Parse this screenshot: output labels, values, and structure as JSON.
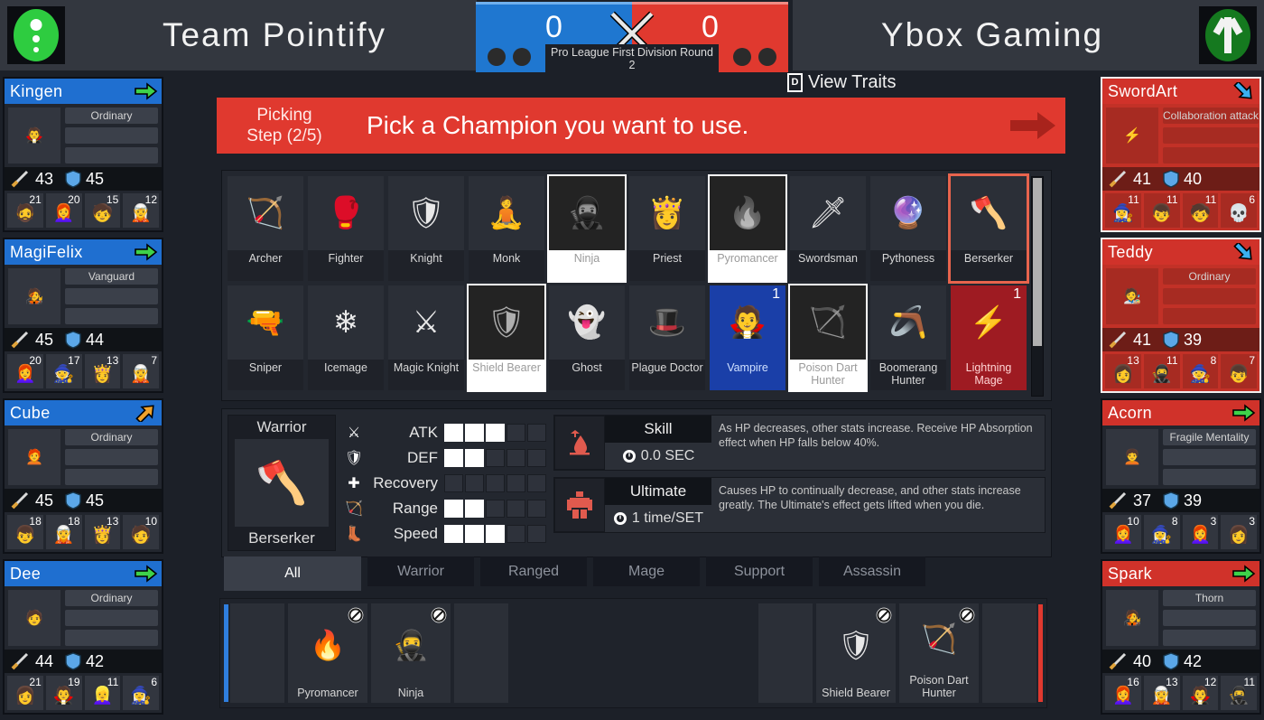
{
  "header": {
    "blue_team_name": "Team Pointify",
    "red_team_name": "Ybox Gaming",
    "blue_score": "0",
    "red_score": "0",
    "round_label": "Pro League First Division Round 2",
    "view_traits_label": "View Traits",
    "view_traits_key": "D",
    "vs_icon": "crossed-swords-icon",
    "blue_logo_icon": "green-oval-dots-logo",
    "red_logo_icon": "green-oval-y-logo"
  },
  "banner": {
    "step_line1": "Picking",
    "step_line2": "Step (2/5)",
    "message": "Pick a Champion you want to use.",
    "arrow_icon": "right-arrow-icon",
    "color": "#e0392f"
  },
  "left_players": [
    {
      "name": "Kingen",
      "arrow": "right-arrow-icon",
      "trait": "Ordinary",
      "atk": "43",
      "def": "45",
      "avatar": "🧛",
      "units": [
        {
          "count": "21",
          "sprite": "🧔"
        },
        {
          "count": "20",
          "sprite": "👩‍🦰"
        },
        {
          "count": "15",
          "sprite": "🧒"
        },
        {
          "count": "12",
          "sprite": "🧝"
        }
      ]
    },
    {
      "name": "MagiFelix",
      "arrow": "right-arrow-icon",
      "trait": "Vanguard",
      "atk": "45",
      "def": "44",
      "avatar": "🧑‍🎤",
      "units": [
        {
          "count": "20",
          "sprite": "👩‍🦰"
        },
        {
          "count": "17",
          "sprite": "🧙"
        },
        {
          "count": "13",
          "sprite": "👸"
        },
        {
          "count": "7",
          "sprite": "🧝"
        }
      ]
    },
    {
      "name": "Cube",
      "arrow": "up-right-arrow-icon",
      "trait": "Ordinary",
      "atk": "45",
      "def": "45",
      "avatar": "🧑‍🦰",
      "units": [
        {
          "count": "18",
          "sprite": "👦"
        },
        {
          "count": "18",
          "sprite": "🧝"
        },
        {
          "count": "13",
          "sprite": "👸"
        },
        {
          "count": "10",
          "sprite": "🧑"
        }
      ]
    },
    {
      "name": "Dee",
      "arrow": "right-arrow-icon",
      "trait": "Ordinary",
      "atk": "44",
      "def": "42",
      "avatar": "🧑",
      "units": [
        {
          "count": "21",
          "sprite": "👩"
        },
        {
          "count": "19",
          "sprite": "🧛"
        },
        {
          "count": "11",
          "sprite": "👱‍♀️"
        },
        {
          "count": "6",
          "sprite": "🧙‍♀️"
        }
      ]
    }
  ],
  "right_players": [
    {
      "name": "SwordArt",
      "arrow": "down-right-arrow-icon",
      "trait": "Collaboration attack",
      "atk": "41",
      "def": "40",
      "avatar": "⚡",
      "style": "red",
      "units": [
        {
          "count": "11",
          "sprite": "🧙‍♀️"
        },
        {
          "count": "11",
          "sprite": "👦"
        },
        {
          "count": "11",
          "sprite": "🧒"
        },
        {
          "count": "6",
          "sprite": "💀"
        }
      ]
    },
    {
      "name": "Teddy",
      "arrow": "down-right-arrow-icon",
      "trait": "Ordinary",
      "atk": "41",
      "def": "39",
      "avatar": "🧑‍🎨",
      "style": "red",
      "units": [
        {
          "count": "13",
          "sprite": "👩"
        },
        {
          "count": "11",
          "sprite": "🥷"
        },
        {
          "count": "8",
          "sprite": "🧙"
        },
        {
          "count": "7",
          "sprite": "👦"
        }
      ]
    },
    {
      "name": "Acorn",
      "arrow": "right-arrow-icon",
      "trait": "Fragile Mentality",
      "atk": "37",
      "def": "39",
      "avatar": "🧑‍🦱",
      "style": "dark",
      "units": [
        {
          "count": "10",
          "sprite": "👩‍🦰"
        },
        {
          "count": "8",
          "sprite": "🧙‍♀️"
        },
        {
          "count": "3",
          "sprite": "👩‍🦰"
        },
        {
          "count": "3",
          "sprite": "👩"
        }
      ]
    },
    {
      "name": "Spark",
      "arrow": "right-arrow-icon",
      "trait": "Thorn",
      "atk": "40",
      "def": "42",
      "avatar": "🧑‍🎤",
      "style": "dark",
      "units": [
        {
          "count": "16",
          "sprite": "👩‍🦰"
        },
        {
          "count": "13",
          "sprite": "🧝"
        },
        {
          "count": "12",
          "sprite": "🧛"
        },
        {
          "count": "11",
          "sprite": "🥷"
        }
      ]
    }
  ],
  "champion_grid": {
    "row1": [
      {
        "name": "Archer",
        "state": "normal",
        "sprite": "🏹"
      },
      {
        "name": "Fighter",
        "state": "normal",
        "sprite": "🥊"
      },
      {
        "name": "Knight",
        "state": "normal",
        "sprite": "🛡"
      },
      {
        "name": "Monk",
        "state": "normal",
        "sprite": "🧘"
      },
      {
        "name": "Ninja",
        "state": "banned",
        "sprite": "🥷"
      },
      {
        "name": "Priest",
        "state": "normal",
        "sprite": "👸"
      },
      {
        "name": "Pyromancer",
        "state": "banned",
        "sprite": "🔥"
      },
      {
        "name": "Swordsman",
        "state": "normal",
        "sprite": "🗡"
      },
      {
        "name": "Pythoness",
        "state": "normal",
        "sprite": "🔮"
      },
      {
        "name": "Berserker",
        "state": "selected",
        "sprite": "🪓"
      }
    ],
    "row2": [
      {
        "name": "Sniper",
        "state": "normal",
        "sprite": "🔫"
      },
      {
        "name": "Icemage",
        "state": "normal",
        "sprite": "❄"
      },
      {
        "name": "Magic Knight",
        "state": "normal",
        "sprite": "⚔"
      },
      {
        "name": "Shield Bearer",
        "state": "banned",
        "sprite": "🛡"
      },
      {
        "name": "Ghost",
        "state": "normal",
        "sprite": "👻"
      },
      {
        "name": "Plague Doctor",
        "state": "normal",
        "sprite": "🎩"
      },
      {
        "name": "Vampire",
        "state": "pickblue",
        "count": "1",
        "sprite": "🧛"
      },
      {
        "name": "Poison Dart Hunter",
        "state": "banned",
        "sprite": "🏹"
      },
      {
        "name": "Boomerang Hunter",
        "state": "normal",
        "sprite": "🪃"
      },
      {
        "name": "Lightning Mage",
        "state": "pickred",
        "count": "1",
        "sprite": "⚡"
      }
    ],
    "ban_icon": "prohibited-icon"
  },
  "detail": {
    "class_tag": "Warrior",
    "champion_name": "Berserker",
    "sprite": "🪓",
    "stats": [
      {
        "icon": "crossed-swords-icon",
        "glyph": "⚔",
        "label": "ATK",
        "value": 3,
        "max": 5
      },
      {
        "icon": "shield-icon",
        "glyph": "🛡",
        "label": "DEF",
        "value": 2,
        "max": 5
      },
      {
        "icon": "plus-cross-icon",
        "glyph": "✚",
        "label": "Recovery",
        "value": 0,
        "max": 5
      },
      {
        "icon": "bow-icon",
        "glyph": "🏹",
        "label": "Range",
        "value": 2,
        "max": 5
      },
      {
        "icon": "boot-icon",
        "glyph": "👢",
        "label": "Speed",
        "value": 3,
        "max": 5
      }
    ],
    "skill": {
      "icon": "blood-drop-up-icon",
      "title": "Skill",
      "cost_icon": "clock-icon",
      "cost": "0.0 SEC",
      "description": "As HP decreases, other stats increase. Receive HP Absorption effect when HP falls below 40%."
    },
    "ultimate": {
      "icon": "armored-figure-icon",
      "title": "Ultimate",
      "cost_icon": "clock-icon",
      "cost": "1 time/SET",
      "description": "Causes HP to continually decrease, and other stats increase greatly. The Ultimate's effect gets lifted when you die."
    }
  },
  "filter_tabs": [
    {
      "label": "All",
      "active": true
    },
    {
      "label": "Warrior",
      "active": false
    },
    {
      "label": "Ranged",
      "active": false
    },
    {
      "label": "Mage",
      "active": false
    },
    {
      "label": "Support",
      "active": false
    },
    {
      "label": "Assassin",
      "active": false
    }
  ],
  "ban_bar": {
    "blue_bans": [
      {
        "name": "Pyromancer",
        "sprite": "🔥"
      },
      {
        "name": "Ninja",
        "sprite": "🥷"
      }
    ],
    "red_bans": [
      {
        "name": "Shield Bearer",
        "sprite": "🛡"
      },
      {
        "name": "Poison Dart Hunter",
        "sprite": "🏹"
      }
    ],
    "ban_icon": "prohibited-icon"
  },
  "colors": {
    "blue": "#1f77d0",
    "red": "#e0392f",
    "panel": "#23272f",
    "background": "#1c2028"
  }
}
